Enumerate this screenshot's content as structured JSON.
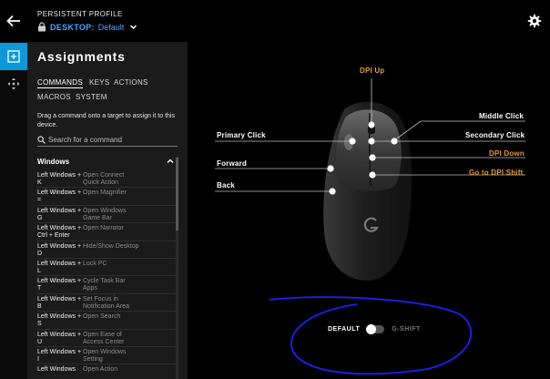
{
  "header": {
    "profile_label": "PERSISTENT PROFILE",
    "profile_env": "DESKTOP:",
    "profile_name": "Default"
  },
  "panel": {
    "title": "Assignments",
    "tabs": [
      {
        "label": "COMMANDS",
        "active": true
      },
      {
        "label": "KEYS",
        "active": false
      },
      {
        "label": "ACTIONS",
        "active": false
      },
      {
        "label": "MACROS",
        "active": false
      },
      {
        "label": "SYSTEM",
        "active": false
      }
    ],
    "hint": "Drag a command onto a target to assign it to this device.",
    "search_placeholder": "Search for a command",
    "section": "Windows",
    "items": [
      {
        "key": "Left Windows + K",
        "action": "Open Connect Quick Action"
      },
      {
        "key": "Left Windows + =",
        "action": "Open Magnifier"
      },
      {
        "key": "Left Windows + G",
        "action": "Open Windows Game Bar"
      },
      {
        "key": "Left Windows + Ctrl + Enter",
        "action": "Open Narrator"
      },
      {
        "key": "Left Windows + D",
        "action": "Hide/Show Desktop"
      },
      {
        "key": "Left Windows + L",
        "action": "Lock PC"
      },
      {
        "key": "Left Windows + T",
        "action": "Cycle Task Bar Apps"
      },
      {
        "key": "Left Windows + B",
        "action": "Set Focus in Notification Area"
      },
      {
        "key": "Left Windows + S",
        "action": "Open Search"
      },
      {
        "key": "Left Windows + U",
        "action": "Open Ease of Access Center"
      },
      {
        "key": "Left Windows + I",
        "action": "Open Windows Setting"
      },
      {
        "key": "Left Windows",
        "action": "Open Action"
      }
    ]
  },
  "mouse": {
    "labels": {
      "dpi_up": "DPI Up",
      "middle_click": "Middle Click",
      "primary_click": "Primary Click",
      "secondary_click": "Secondary Click",
      "dpi_down": "DPI Down",
      "forward": "Forward",
      "go_to_dpi_shift": "Go to DPI Shift",
      "back": "Back"
    },
    "accent_color": "#e39b3a"
  },
  "mode": {
    "default": "DEFAULT",
    "gshift": "G-SHIFT"
  },
  "icons": {
    "back": "arrow-left-icon",
    "settings": "gear-icon",
    "lock": "lock-icon",
    "assignments": "plus-square-icon",
    "dpi": "move-arrows-icon",
    "search": "search-icon",
    "brand": "g-logo-icon"
  }
}
